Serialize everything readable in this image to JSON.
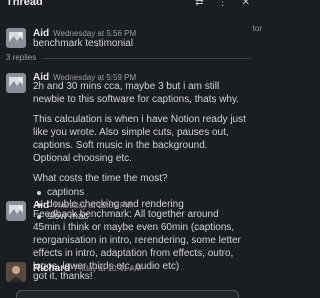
{
  "header": {
    "title": "Thread"
  },
  "messages": [
    {
      "author": "Aid",
      "time": "Wednesday at 5:56 PM",
      "lines": [
        "benchmark testimonial"
      ]
    },
    {
      "author": "Aid",
      "time": "Wednesday at 5:59 PM",
      "paragraphs": [
        "2h and 30 mins cca, maybe 3 but i am still newbie to this software for captions, thats why.",
        "This calculation is when i have Notion ready just like you wrote. Also simple cuts, pauses out, captions. Soft music in the background. Optional choosing etc.",
        "What costs the time the most?"
      ],
      "bullets": [
        "captions",
        "double checking and rendering",
        "slow mac"
      ]
    },
    {
      "author": "Aid",
      "time": "Thursday at 12:55 PM",
      "paragraphs": [
        "Feedback benchmark: All together around 45min i think or maybe even 60min (captions, reorganisation in intro, rerendering, some letter effects in intro, adaptation from effects, outro, logos, lower thirds etc, audio etc)"
      ]
    },
    {
      "author": "Richard",
      "time": "Friday at 10:41 AM",
      "lines": [
        "got it, thanks!"
      ]
    }
  ],
  "replies_label": "3 replies",
  "edge_text": "tor"
}
